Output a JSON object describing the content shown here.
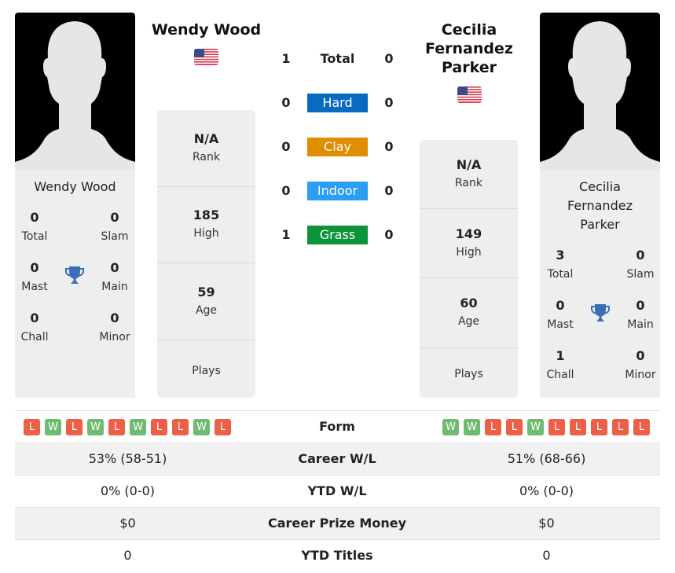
{
  "player1": {
    "name": "Wendy Wood",
    "card_name": "Wendy Wood",
    "flag": "us-flag",
    "titles": {
      "total": "0",
      "slam": "0",
      "mast": "0",
      "main": "0",
      "chall": "0",
      "minor": "0"
    },
    "info": {
      "rank": "N/A",
      "high": "185",
      "age": "59",
      "plays": ""
    },
    "form": [
      "L",
      "W",
      "L",
      "W",
      "L",
      "W",
      "L",
      "L",
      "W",
      "L"
    ],
    "career_wl": "53% (58-51)",
    "ytd_wl": "0% (0-0)",
    "prize_money": "$0",
    "ytd_titles": "0"
  },
  "player2": {
    "name": "Cecilia Fernandez Parker",
    "name_lines": [
      "Cecilia",
      "Fernandez",
      "Parker"
    ],
    "card_name_lines": [
      "Cecilia",
      "Fernandez",
      "Parker"
    ],
    "flag": "us-flag",
    "titles": {
      "total": "3",
      "slam": "0",
      "mast": "0",
      "main": "0",
      "chall": "1",
      "minor": "0"
    },
    "info": {
      "rank": "N/A",
      "high": "149",
      "age": "60",
      "plays": ""
    },
    "form": [
      "W",
      "W",
      "L",
      "L",
      "W",
      "L",
      "L",
      "L",
      "L",
      "L"
    ],
    "career_wl": "51% (68-66)",
    "ytd_wl": "0% (0-0)",
    "prize_money": "$0",
    "ytd_titles": "0"
  },
  "labels": {
    "total": "Total",
    "slam": "Slam",
    "mast": "Mast",
    "main": "Main",
    "chall": "Chall",
    "minor": "Minor",
    "rank": "Rank",
    "high": "High",
    "age": "Age",
    "plays": "Plays"
  },
  "h2h": [
    {
      "label": "Total",
      "p1": "1",
      "p2": "0",
      "color": ""
    },
    {
      "label": "Hard",
      "p1": "0",
      "p2": "0",
      "color": "#0a6ac2"
    },
    {
      "label": "Clay",
      "p1": "0",
      "p2": "0",
      "color": "#e08d00"
    },
    {
      "label": "Indoor",
      "p1": "0",
      "p2": "0",
      "color": "#2a9ef2"
    },
    {
      "label": "Grass",
      "p1": "1",
      "p2": "0",
      "color": "#0d9439"
    }
  ],
  "table": {
    "form": "Form",
    "career_wl": "Career W/L",
    "ytd_wl": "YTD W/L",
    "prize_money": "Career Prize Money",
    "ytd_titles": "YTD Titles"
  },
  "colors": {
    "win": "#6fbb72",
    "loss": "#ee5f48",
    "trophy": "#3a6fb8"
  }
}
